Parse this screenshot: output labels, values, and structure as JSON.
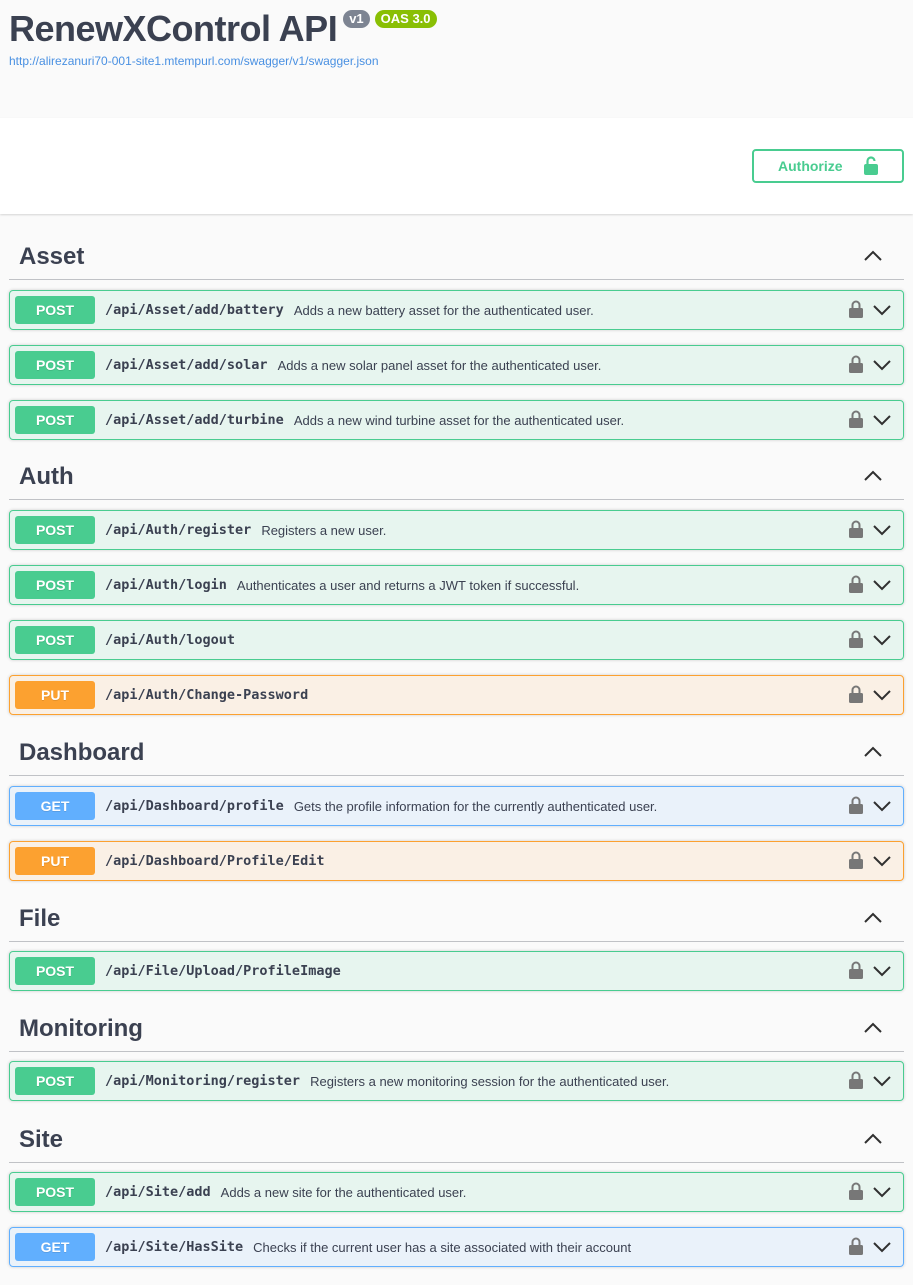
{
  "info": {
    "title": "RenewXControl API",
    "version_badge": "v1",
    "oas_badge": "OAS 3.0",
    "spec_url": "http://alirezanuri70-001-site1.mtempurl.com/swagger/v1/swagger.json"
  },
  "authorize": {
    "label": "Authorize"
  },
  "tags": [
    {
      "name": "Asset",
      "operations": [
        {
          "method": "POST",
          "path": "/api/Asset/add/battery",
          "summary": "Adds a new battery asset for the authenticated user."
        },
        {
          "method": "POST",
          "path": "/api/Asset/add/solar",
          "summary": "Adds a new solar panel asset for the authenticated user."
        },
        {
          "method": "POST",
          "path": "/api/Asset/add/turbine",
          "summary": "Adds a new wind turbine asset for the authenticated user."
        }
      ]
    },
    {
      "name": "Auth",
      "operations": [
        {
          "method": "POST",
          "path": "/api/Auth/register",
          "summary": "Registers a new user."
        },
        {
          "method": "POST",
          "path": "/api/Auth/login",
          "summary": "Authenticates a user and returns a JWT token if successful."
        },
        {
          "method": "POST",
          "path": "/api/Auth/logout",
          "summary": ""
        },
        {
          "method": "PUT",
          "path": "/api/Auth/Change-Password",
          "summary": ""
        }
      ]
    },
    {
      "name": "Dashboard",
      "operations": [
        {
          "method": "GET",
          "path": "/api/Dashboard/profile",
          "summary": "Gets the profile information for the currently authenticated user."
        },
        {
          "method": "PUT",
          "path": "/api/Dashboard/Profile/Edit",
          "summary": ""
        }
      ]
    },
    {
      "name": "File",
      "operations": [
        {
          "method": "POST",
          "path": "/api/File/Upload/ProfileImage",
          "summary": ""
        }
      ]
    },
    {
      "name": "Monitoring",
      "operations": [
        {
          "method": "POST",
          "path": "/api/Monitoring/register",
          "summary": "Registers a new monitoring session for the authenticated user."
        }
      ]
    },
    {
      "name": "Site",
      "operations": [
        {
          "method": "POST",
          "path": "/api/Site/add",
          "summary": "Adds a new site for the authenticated user."
        },
        {
          "method": "GET",
          "path": "/api/Site/HasSite",
          "summary": "Checks if the current user has a site associated with their account"
        }
      ]
    }
  ],
  "colors": {
    "post": "#49cc90",
    "put": "#fca130",
    "get": "#61affe",
    "authorize": "#49cc90"
  },
  "icons": {
    "tag_toggle": "chevron-up-icon",
    "operation_lock": "lock-icon",
    "operation_expand": "chevron-down-icon",
    "authorize_lock": "lock-open-icon"
  }
}
